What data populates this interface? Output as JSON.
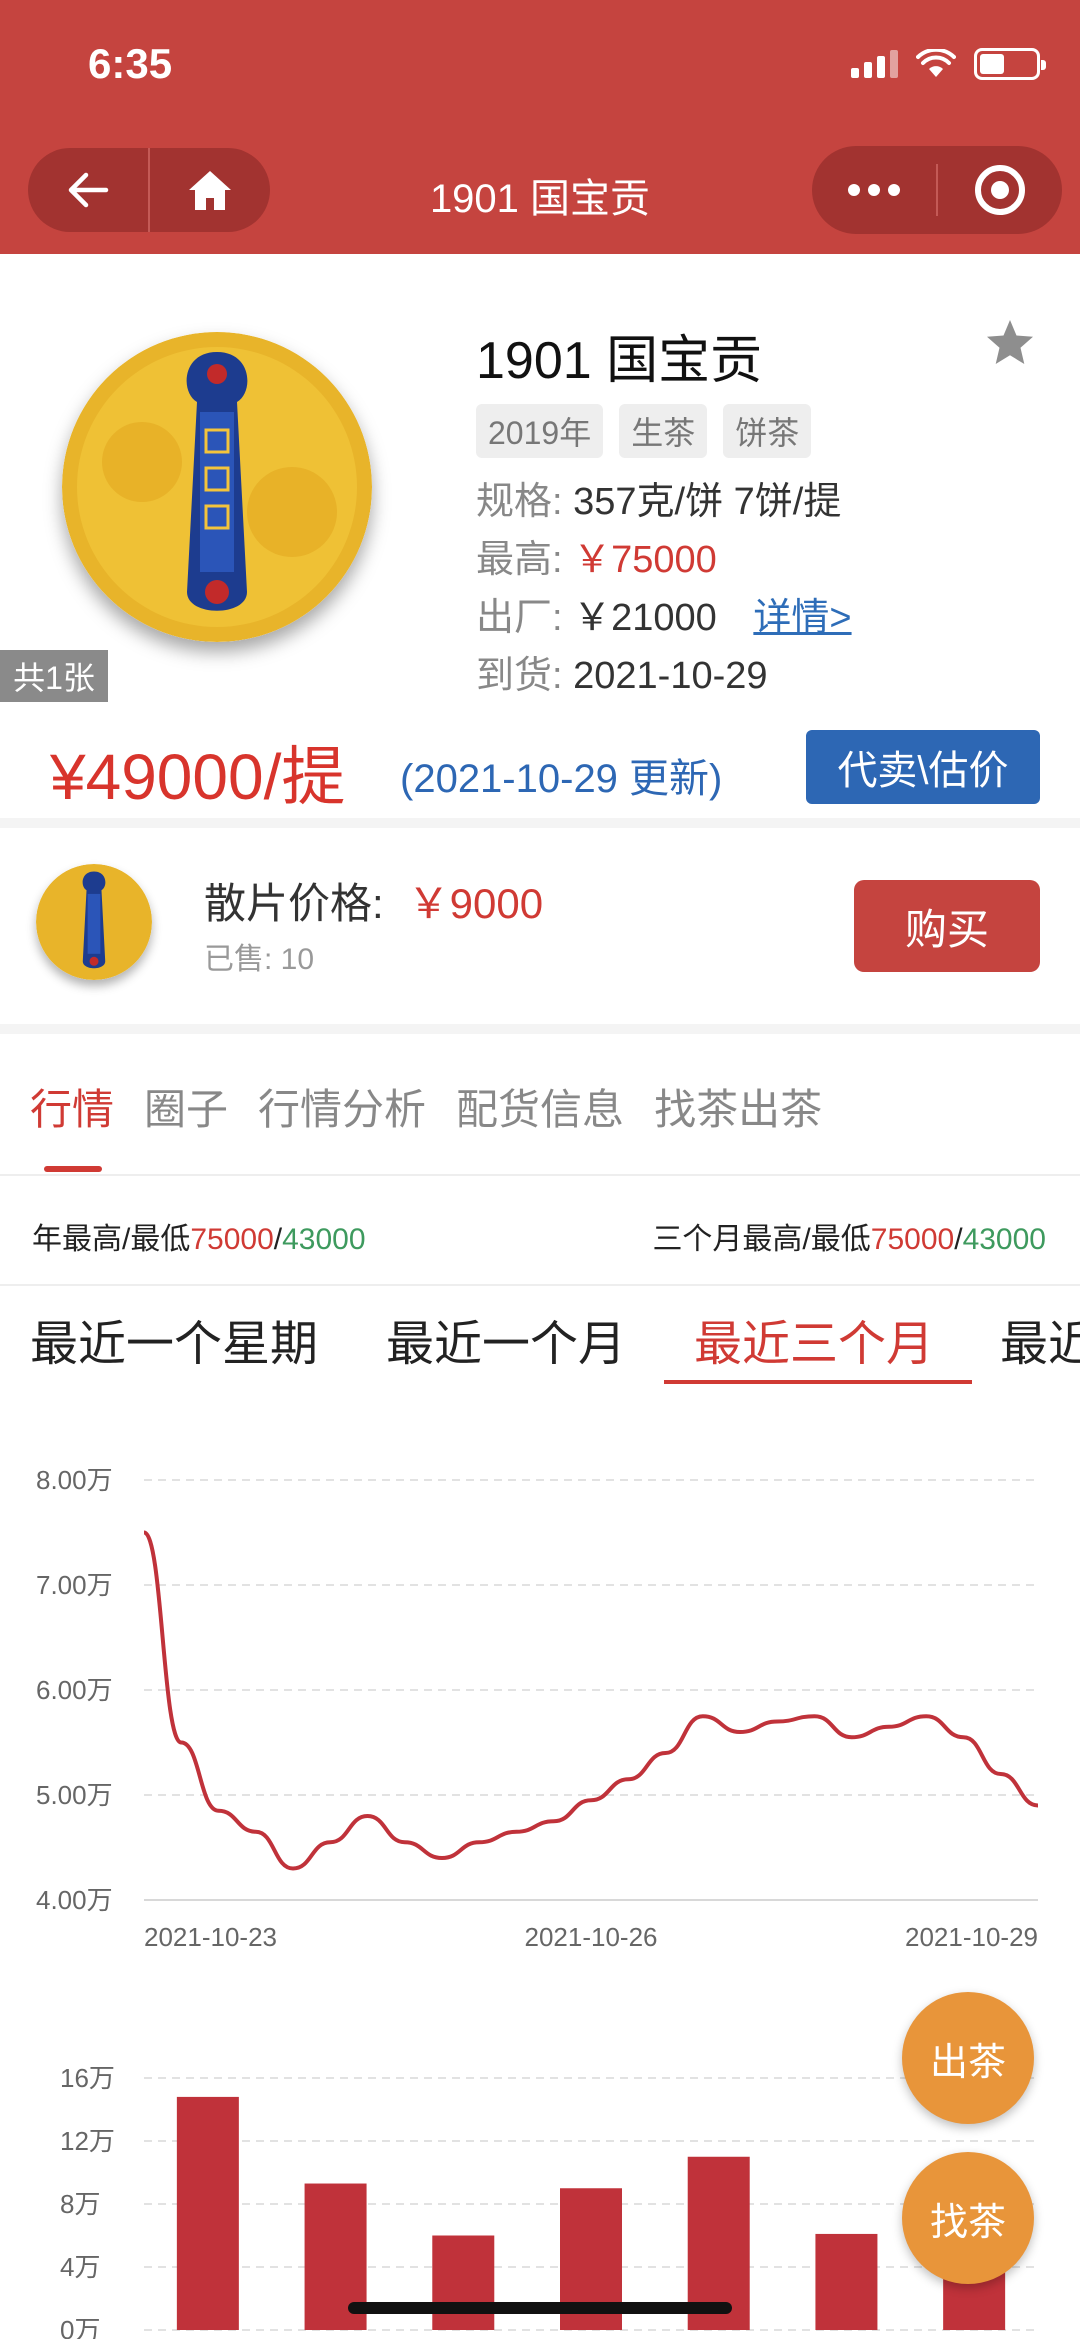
{
  "status": {
    "time": "6:35"
  },
  "nav": {
    "title": "1901 国宝贡"
  },
  "product": {
    "title": "1901 国宝贡",
    "image_count": "共1张",
    "tags": [
      "2019年",
      "生茶",
      "饼茶"
    ],
    "spec_label": "规格:",
    "spec_value": "357克/饼 7饼/提",
    "high_label": "最高:",
    "high_value": "￥75000",
    "factory_label": "出厂:",
    "factory_value": "￥21000",
    "details_link": "详情>",
    "arrival_label": "到货:",
    "arrival_value": "2021-10-29",
    "price": "¥49000/提",
    "update": "(2021-10-29 更新)",
    "consign_button": "代卖\\估价"
  },
  "loose": {
    "label": "散片价格:",
    "price": "￥9000",
    "sold": "已售: 10",
    "buy_button": "购买"
  },
  "tabs": [
    "行情",
    "圈子",
    "行情分析",
    "配货信息",
    "找茶出茶"
  ],
  "ranges": {
    "year_label": "年最高/最低",
    "year_high": "75000",
    "year_low": "43000",
    "three_month_label": "三个月最高/最低",
    "three_month_high": "75000",
    "three_month_low": "43000",
    "slash": "/"
  },
  "periods": [
    "最近一个星期",
    "最近一个月",
    "最近三个月",
    "最近"
  ],
  "fab": {
    "sell": "出茶",
    "find": "找茶"
  },
  "colors": {
    "brand_red": "#c5443f",
    "price_red": "#d8342c",
    "blue": "#2d67b4",
    "green": "#3e9a5e",
    "orange": "#e8953a"
  },
  "chart_data": [
    {
      "type": "line",
      "y_tick_labels": [
        "8.00万",
        "7.00万",
        "6.00万",
        "5.00万",
        "4.00万"
      ],
      "x_tick_labels": [
        "2021-10-23",
        "2021-10-26",
        "2021-10-29"
      ],
      "ylim": [
        40000,
        80000
      ],
      "x": [
        "10-22",
        "10-22",
        "10-23",
        "10-23",
        "10-23",
        "10-24",
        "10-24",
        "10-24",
        "10-24",
        "10-25",
        "10-25",
        "10-25",
        "10-26",
        "10-26",
        "10-26",
        "10-27",
        "10-27",
        "10-27",
        "10-27",
        "10-28",
        "10-28",
        "10-28",
        "10-29",
        "10-29",
        "10-29"
      ],
      "series": [
        {
          "values": [
            75000,
            55000,
            48500,
            46500,
            43000,
            45500,
            48000,
            45500,
            44000,
            45500,
            46500,
            47500,
            49500,
            51500,
            54000,
            57500,
            56000,
            57000,
            57500,
            55500,
            56500,
            57500,
            55500,
            52000,
            49000
          ]
        }
      ],
      "grid": true
    },
    {
      "type": "bar",
      "y_tick_labels": [
        "16万",
        "12万",
        "8万",
        "4万",
        "0万"
      ],
      "ylim": [
        0,
        160000
      ],
      "values": [
        148000,
        93000,
        60000,
        90000,
        110000,
        61000,
        56000
      ],
      "grid": true
    }
  ]
}
